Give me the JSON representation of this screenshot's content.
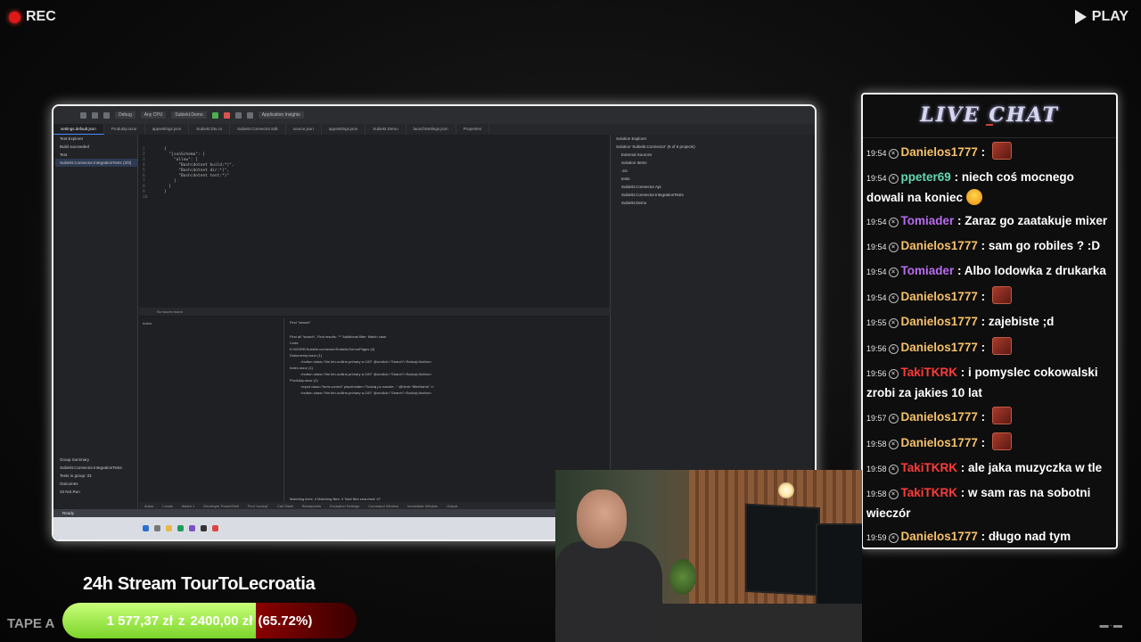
{
  "overlay": {
    "rec_label": "REC",
    "play_label": "PLAY",
    "tape_label": "TAPE A",
    "corner_mark": "▬·▬"
  },
  "ide": {
    "toolbar_items": [
      "Debug",
      "Any CPU",
      "Subiekt.Demo",
      "Application Insights"
    ],
    "tabs": [
      "settings.default.json",
      "Produkty.razor",
      "appsettings.json",
      "Subiekt.Dts.cs",
      "Subiekt.Connector.Sdk",
      "source.json",
      "appsettings.json",
      "Subiekt.Demo",
      "launchSettings.json",
      "Properties"
    ],
    "left_panel_rows": [
      "Test Explorer",
      "Build succeeded",
      "Test",
      "Subiekt.Connector.IntegrationTests (3/3)"
    ],
    "left_panel_summary": [
      "Group Summary",
      "Subiekt.Connector.IntegrationTests",
      "Tests in group: 33",
      "Outcomes",
      "33 Not Run"
    ],
    "code_lines": [
      "{",
      "  \"jsonSchema\": {",
      "    \"allow\": [",
      "      \"Bash(dotnet build:*)\",",
      "      \"Bash(dotnet dir:*)\",",
      "      \"Bash(dotnet test:*)\"",
      "    ]",
      "  }",
      "}",
      ""
    ],
    "editor_status": "No issues found",
    "find_header": "Find \"search\"",
    "find_rows": [
      "Find all \"search\", Find results: \"*\"  Additional filter: Match case",
      "Code",
      "D:\\WORK\\Subiekt.connector\\Subiekt.Demo\\Pages (4)",
      "Dokumenty.razor (1)",
      "<button class=\"btn btn-outline-primary w-100\" @onclick=\"Search\">Szukaj</button>",
      "Index.razor (1)",
      "<button class=\"btn btn-outline-primary w-100\" @onclick=\"Search\">Szukaj</button>",
      "Produkty.razor (2)",
      "<input class=\"form-control\" placeholder=\"Szukaj po nazwie...\" @bind=\"filterName\" />",
      "<button class=\"btn btn-outline-primary w-100\" @onclick=\"Search\">Szukaj</button>"
    ],
    "find_footer": "Matching lines: 4  Matching files: 3  Total files searched: 67",
    "autos_label": "Autos",
    "solution_rows": [
      "Solution Explorer",
      "Solution 'Subiekt.Connector' (6 of 6 projects)",
      "External Sources",
      "Solution Items",
      ".src",
      "tests",
      "Subiekt.Connector.Api",
      "Subiekt.Connector.IntegrationTests",
      "Subiekt.Demo"
    ],
    "bottom_tabs": [
      "Autos",
      "Locals",
      "Watch 1",
      "Developer PowerShell",
      "Find \"szukaj\"",
      "Call Stack",
      "Breakpoints",
      "Exception Settings",
      "Command Window",
      "Immediate Window",
      "Output"
    ],
    "status_bar": "Ready"
  },
  "chat": {
    "logo": "LIVE CHAT",
    "messages": [
      {
        "time": "19:54",
        "user": "Danielos1777",
        "color": "#f5c06a",
        "text": "",
        "emote": "rage"
      },
      {
        "time": "19:54",
        "user": "ppeter69",
        "color": "#63d9b0",
        "text": "niech coś mocnego dowali na koniec",
        "emote": "laugh"
      },
      {
        "time": "19:54",
        "user": "Tomiader",
        "color": "#b86bf0",
        "text": "Zaraz go zaatakuje mixer",
        "emote": ""
      },
      {
        "time": "19:54",
        "user": "Danielos1777",
        "color": "#f5c06a",
        "text": "sam go robiles ? :D",
        "emote": ""
      },
      {
        "time": "19:54",
        "user": "Tomiader",
        "color": "#b86bf0",
        "text": "Albo lodowka z drukarka",
        "emote": ""
      },
      {
        "time": "19:54",
        "user": "Danielos1777",
        "color": "#f5c06a",
        "text": "",
        "emote": "rage"
      },
      {
        "time": "19:55",
        "user": "Danielos1777",
        "color": "#f5c06a",
        "text": "zajebiste ;d",
        "emote": ""
      },
      {
        "time": "19:56",
        "user": "Danielos1777",
        "color": "#f5c06a",
        "text": "",
        "emote": "rage"
      },
      {
        "time": "19:56",
        "user": "TakiTKRK",
        "color": "#ff3b3b",
        "text": "i pomyslec cokowalski zrobi za jakies 10 lat",
        "emote": ""
      },
      {
        "time": "19:57",
        "user": "Danielos1777",
        "color": "#f5c06a",
        "text": "",
        "emote": "rage"
      },
      {
        "time": "19:58",
        "user": "Danielos1777",
        "color": "#f5c06a",
        "text": "",
        "emote": "rage"
      },
      {
        "time": "19:58",
        "user": "TakiTKRK",
        "color": "#ff3b3b",
        "text": "ale jaka muzyczka w tle",
        "emote": ""
      },
      {
        "time": "19:58",
        "user": "TakiTKRK",
        "color": "#ff3b3b",
        "text": "w sam ras na sobotni wieczór",
        "emote": ""
      },
      {
        "time": "19:59",
        "user": "Danielos1777",
        "color": "#f5c06a",
        "text": "długo nad tym pracowales ?",
        "emote": ""
      }
    ]
  },
  "stream": {
    "title": "24h Stream TourToLecroatia",
    "raised": "1 577,37 zł",
    "separator": "z",
    "goal": "2400,00 zł",
    "percent_label": "(65.72%)",
    "progress_fraction": 0.6572
  }
}
